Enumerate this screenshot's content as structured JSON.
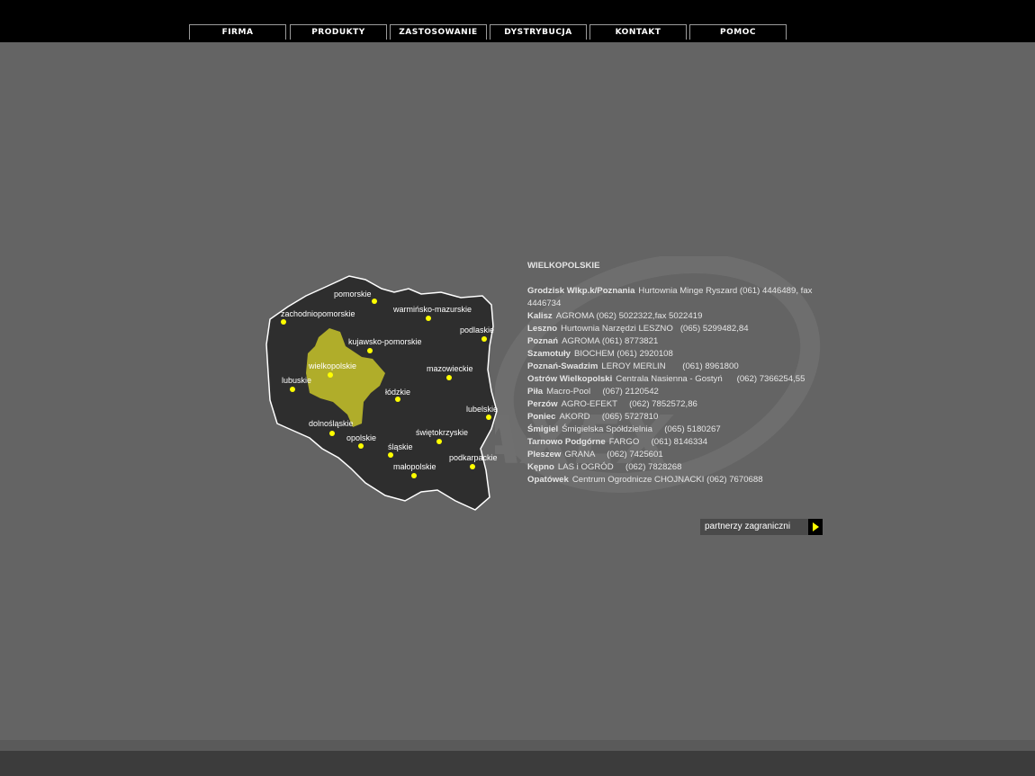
{
  "nav": {
    "items": [
      "FIRMA",
      "PRODUKTY",
      "ZASTOSOWANIE",
      "DYSTRYBUCJA",
      "KONTAKT",
      "POMOC"
    ]
  },
  "map": {
    "regions": [
      "pomorskie",
      "zachodniopomorskie",
      "warmińsko-mazurskie",
      "podlaskie",
      "kujawsko-pomorskie",
      "wielkopolskie",
      "mazowieckie",
      "lubuskie",
      "łódzkie",
      "lubelskie",
      "dolnośląskie",
      "świętokrzyskie",
      "opolskie",
      "śląskie",
      "podkarpackie",
      "małopolskie"
    ],
    "highlighted": "wielkopolskie",
    "highlight_color": "#b0ad2a",
    "dot_color": "#ffff00"
  },
  "info": {
    "title": "WIELKOPOLSKIE",
    "entries": [
      {
        "city": "Grodzisk Wlkp.k/Poznania",
        "text": "Hurtownia Minge Ryszard (061) 4446489, fax 4446734"
      },
      {
        "city": "Kalisz",
        "text": "AGROMA (062) 5022322,fax 5022419"
      },
      {
        "city": "Leszno",
        "text": "Hurtownia Narzędzi LESZNO   (065) 5299482,84"
      },
      {
        "city": "Poznań",
        "text": "AGROMA (061) 8773821"
      },
      {
        "city": "Szamotuły",
        "text": "BIOCHEM (061) 2920108"
      },
      {
        "city": "Poznań-Swadzim",
        "text": "LEROY MERLIN       (061) 8961800"
      },
      {
        "city": "Ostrów Wielkopolski",
        "text": "Centrala Nasienna - Gostyń      (062) 7366254,55"
      },
      {
        "city": "Piła",
        "text": "Macro-Pool     (067) 2120542"
      },
      {
        "city": "Perzów",
        "text": "AGRO-EFEKT     (062) 7852572,86"
      },
      {
        "city": "Poniec",
        "text": "AKORD     (065) 5727810"
      },
      {
        "city": "Śmigiel",
        "text": "Śmigielska Spółdzielnia     (065) 5180267"
      },
      {
        "city": "Tarnowo Podgórne",
        "text": "FARGO     (061) 8146334"
      },
      {
        "city": "Pleszew",
        "text": "GRANA     (062) 7425601"
      },
      {
        "city": "Kępno",
        "text": "LAS i OGRÓD     (062) 7828268"
      },
      {
        "city": "Opatówek",
        "text": "Centrum Ogrodnicze CHOJNACKI (062) 7670688"
      }
    ]
  },
  "partners_button": {
    "label": "partnerzy zagraniczni",
    "icon": "play-arrow-icon"
  },
  "watermark": {
    "text": "MAXEX"
  }
}
